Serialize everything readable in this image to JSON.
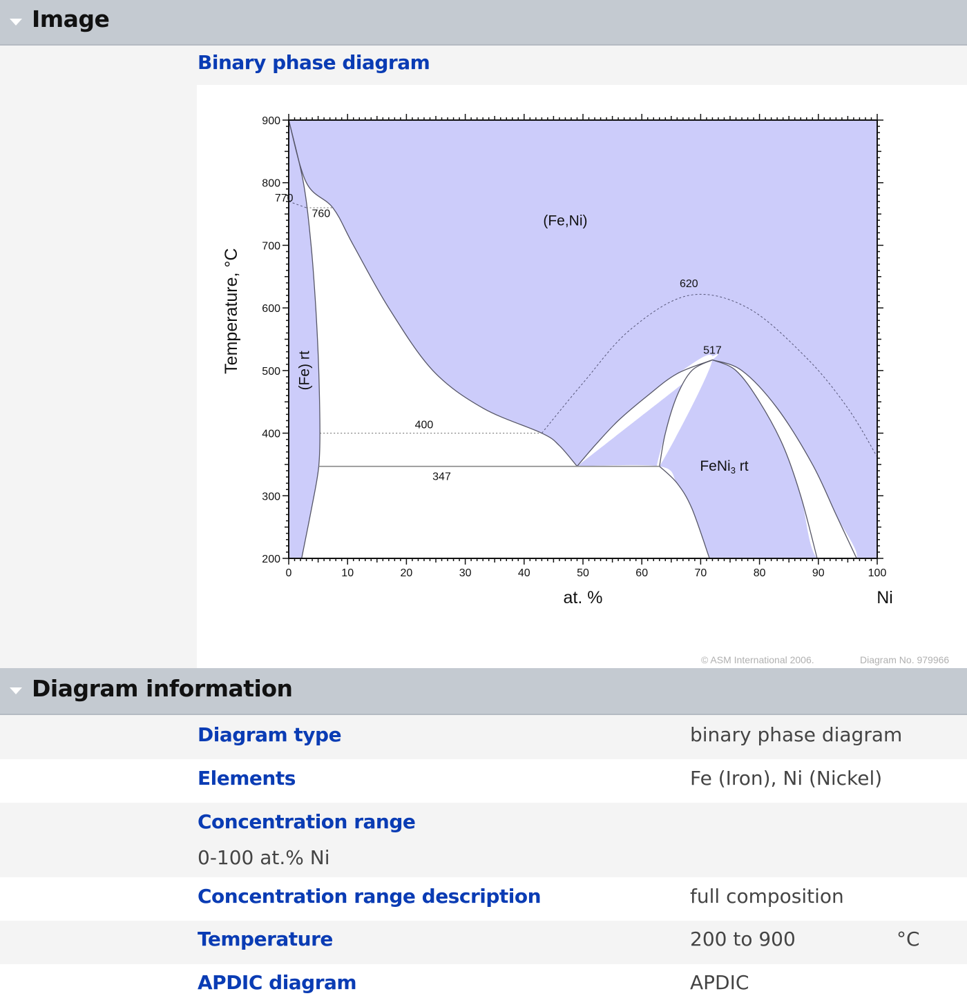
{
  "sections": {
    "image": {
      "title": "Image"
    },
    "info": {
      "title": "Diagram information"
    }
  },
  "image_panel": {
    "label": "Binary phase diagram",
    "copyright": "© ASM International 2006.",
    "diagram_no": "Diagram No. 979966"
  },
  "info_rows": [
    {
      "label": "Diagram type",
      "value": "binary phase diagram"
    },
    {
      "label": "Elements",
      "value": "Fe (Iron), Ni (Nickel)"
    },
    {
      "label": "Concentration range",
      "value": "0-100 at.% Ni"
    },
    {
      "label": "Concentration range description",
      "value": "full composition"
    },
    {
      "label": "Temperature",
      "value": "200 to 900",
      "unit": "°C"
    },
    {
      "label": "APDIC diagram",
      "value": "APDIC"
    }
  ],
  "colors": {
    "phase_fill": "#ccccfa",
    "boundary": "#555566",
    "link_blue": "#0a3cb4",
    "header_bg": "#c4cad1"
  },
  "chart_data": {
    "type": "phase_diagram",
    "title": "Binary phase diagram",
    "xlabel": "at. %",
    "xlabel_right": "Ni",
    "ylabel": "Temperature, °C",
    "xlim": [
      0,
      100
    ],
    "ylim": [
      200,
      900
    ],
    "xticks": [
      0,
      10,
      20,
      30,
      40,
      50,
      60,
      70,
      80,
      90,
      100
    ],
    "yticks": [
      200,
      300,
      400,
      500,
      600,
      700,
      800,
      900
    ],
    "grid": false,
    "phases": [
      {
        "name": "(Fe) rt",
        "label_at": [
          2.5,
          500
        ],
        "vertical": true
      },
      {
        "name": "(Fe,Ni)",
        "label_at": [
          47,
          732
        ]
      },
      {
        "name": "FeNi3 rt",
        "label_at": [
          74,
          340
        ]
      }
    ],
    "boundaries": {
      "fe_solvus_left": [
        [
          0,
          900
        ],
        [
          0.6,
          800
        ],
        [
          1.2,
          700
        ],
        [
          1.8,
          600
        ],
        [
          2.1,
          500
        ],
        [
          2.2,
          400
        ],
        [
          2.4,
          347
        ],
        [
          2.2,
          300
        ],
        [
          2.0,
          200
        ]
      ],
      "fe_rt_right": [
        [
          0,
          900
        ],
        [
          2.5,
          800
        ],
        [
          3.8,
          700
        ],
        [
          4.6,
          600
        ],
        [
          5.1,
          500
        ],
        [
          5.3,
          400
        ],
        [
          5.1,
          347
        ],
        [
          4.3,
          300
        ],
        [
          2.2,
          200
        ]
      ],
      "fcc_left": [
        [
          0,
          900
        ],
        [
          3,
          800
        ],
        [
          7.5,
          760
        ],
        [
          11,
          700
        ],
        [
          17,
          600
        ],
        [
          24.5,
          500
        ],
        [
          33,
          440
        ],
        [
          43,
          400
        ],
        [
          46,
          380
        ],
        [
          49,
          347
        ]
      ],
      "fcc_feni3_left": [
        [
          49,
          347
        ],
        [
          52,
          380
        ],
        [
          56,
          420
        ],
        [
          61,
          460
        ],
        [
          66,
          495
        ],
        [
          72,
          517
        ]
      ],
      "feni3_left": [
        [
          72,
          517
        ],
        [
          68.5,
          500
        ],
        [
          66,
          460
        ],
        [
          64,
          400
        ],
        [
          63,
          347
        ],
        [
          66,
          320
        ],
        [
          68.5,
          280
        ],
        [
          71.5,
          200
        ]
      ],
      "feni3_right": [
        [
          72,
          517
        ],
        [
          76,
          500
        ],
        [
          80,
          450
        ],
        [
          84,
          380
        ],
        [
          87,
          300
        ],
        [
          89.8,
          200
        ]
      ],
      "fcc_right": [
        [
          72,
          517
        ],
        [
          77,
          500
        ],
        [
          83,
          440
        ],
        [
          89,
          350
        ],
        [
          93,
          270
        ],
        [
          96.5,
          200
        ]
      ]
    },
    "invariants": [
      {
        "label": "347",
        "T": 347,
        "x_range": [
          5.1,
          63
        ]
      },
      {
        "label": "400",
        "T": 400,
        "x_range": [
          5.3,
          43
        ],
        "dotted": true
      },
      {
        "label": "760",
        "T": 760,
        "x_range": [
          3,
          7.5
        ],
        "dotted": true
      }
    ],
    "magnetic_transitions": [
      {
        "label": "770",
        "points": [
          [
            0,
            770
          ],
          [
            3,
            760
          ]
        ],
        "dotted": true
      },
      {
        "label": "620",
        "points": [
          [
            43,
            400
          ],
          [
            50,
            480
          ],
          [
            58,
            565
          ],
          [
            68,
            620
          ],
          [
            78,
            600
          ],
          [
            88,
            520
          ],
          [
            95,
            440
          ],
          [
            100,
            362
          ]
        ],
        "dotted": true
      }
    ],
    "annotations": [
      {
        "text": "770",
        "at": [
          -0.8,
          770
        ]
      },
      {
        "text": "760",
        "at": [
          5.5,
          745
        ]
      },
      {
        "text": "620",
        "at": [
          68,
          633
        ]
      },
      {
        "text": "517",
        "at": [
          72,
          527
        ]
      },
      {
        "text": "400",
        "at": [
          23,
          408
        ]
      },
      {
        "text": "347",
        "at": [
          26,
          325
        ]
      }
    ]
  }
}
